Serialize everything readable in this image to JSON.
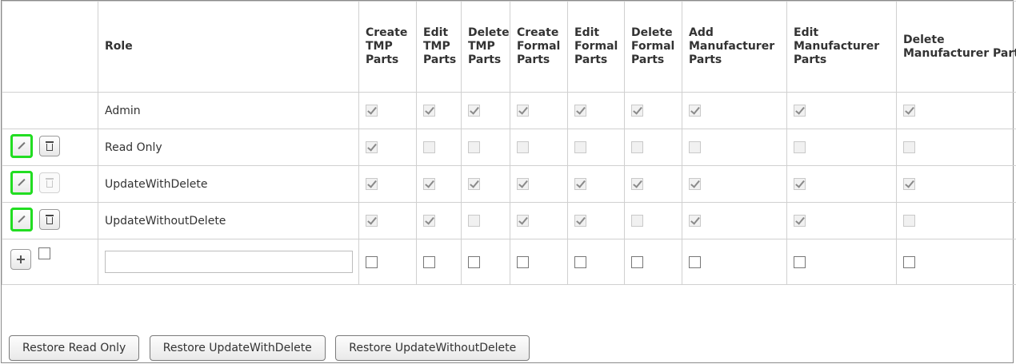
{
  "headers": {
    "role": "Role",
    "columns": [
      "Create TMP Parts",
      "Edit TMP Parts",
      "Delete TMP Parts",
      "Create Formal Parts",
      "Edit Formal Parts",
      "Delete Formal Parts",
      "Add Manufacturer Parts",
      "Edit Manufacturer Parts",
      "Delete Manufacturer Parts"
    ]
  },
  "rows": [
    {
      "name": "Admin",
      "editable": false,
      "delete_enabled": false,
      "perms": [
        true,
        true,
        true,
        true,
        true,
        true,
        true,
        true,
        true
      ]
    },
    {
      "name": "Read Only",
      "editable": true,
      "delete_enabled": true,
      "perms": [
        true,
        false,
        false,
        false,
        false,
        false,
        false,
        false,
        false
      ]
    },
    {
      "name": "UpdateWithDelete",
      "editable": true,
      "delete_enabled": false,
      "perms": [
        true,
        true,
        true,
        true,
        true,
        true,
        true,
        true,
        true
      ]
    },
    {
      "name": "UpdateWithoutDelete",
      "editable": true,
      "delete_enabled": true,
      "perms": [
        true,
        true,
        false,
        true,
        true,
        false,
        true,
        true,
        false
      ]
    }
  ],
  "new_row": {
    "role_value": "",
    "role_placeholder": ""
  },
  "restore_buttons": [
    "Restore Read Only",
    "Restore UpdateWithDelete",
    "Restore UpdateWithoutDelete"
  ],
  "colors": {
    "highlight": "#22dd22",
    "border": "#d0d0d0"
  },
  "icons": {
    "edit": "pencil-icon",
    "delete": "trash-icon",
    "add": "plus-icon"
  }
}
